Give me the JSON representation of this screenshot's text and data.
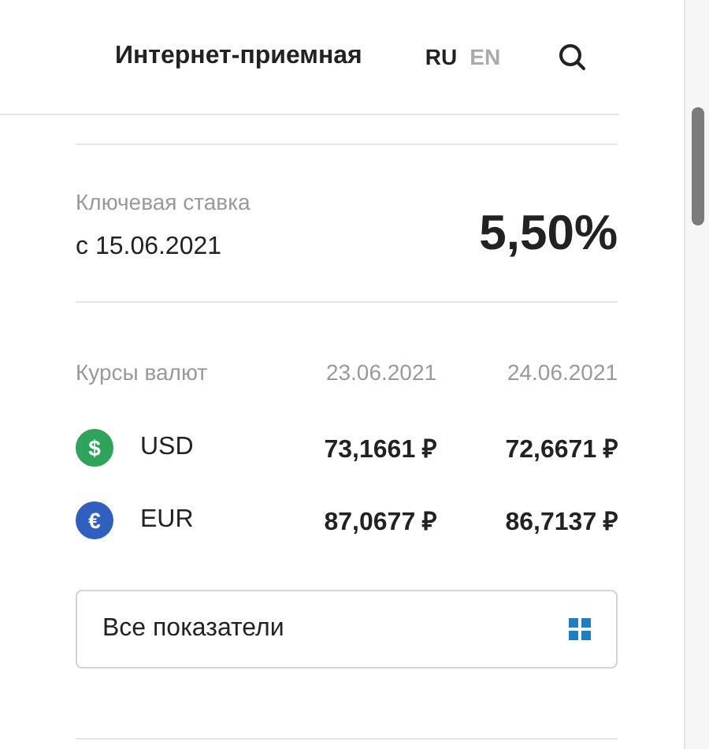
{
  "header": {
    "title": "Интернет-приемная",
    "languages": [
      {
        "label": "RU",
        "selected": true
      },
      {
        "label": "EN",
        "selected": false
      }
    ]
  },
  "key_rate": {
    "label": "Ключевая ставка",
    "date": "с 15.06.2021",
    "value": "5,50%"
  },
  "rates": {
    "label": "Курсы валют",
    "dates": [
      "23.06.2021",
      "24.06.2021"
    ],
    "rows": [
      {
        "symbol": "$",
        "color": "#2ea45a",
        "code": "USD",
        "values": [
          "73,1661 ₽",
          "72,6671 ₽"
        ]
      },
      {
        "symbol": "€",
        "color": "#2f5fbf",
        "code": "EUR",
        "values": [
          "87,0677 ₽",
          "86,7137 ₽"
        ]
      }
    ]
  },
  "all_button": {
    "label": "Все показатели"
  }
}
